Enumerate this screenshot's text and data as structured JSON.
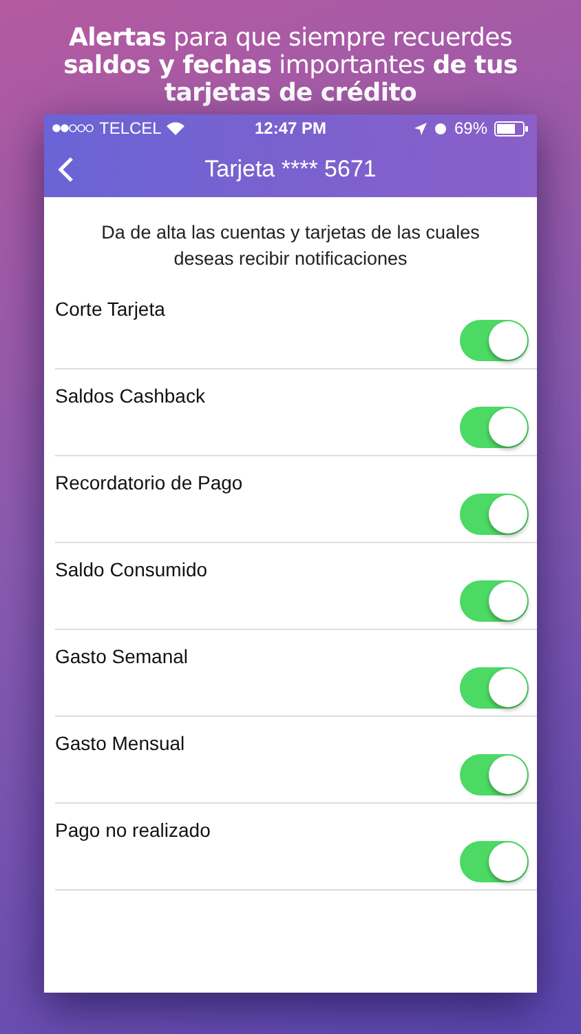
{
  "headline": "**Alertas** para que siempre recuerdes **saldos y fechas** importantes **de tus tarjetas de crédito**",
  "status_bar": {
    "carrier": "TELCEL",
    "time": "12:47 PM",
    "battery": "69%"
  },
  "nav": {
    "title": "Tarjeta **** 5671"
  },
  "intro": "Da de alta las cuentas y tarjetas de las cuales deseas recibir notificaciones",
  "settings": [
    {
      "label": "Corte Tarjeta",
      "on": true
    },
    {
      "label": "Saldos Cashback",
      "on": true
    },
    {
      "label": "Recordatorio de Pago",
      "on": true
    },
    {
      "label": "Saldo Consumido",
      "on": true
    },
    {
      "label": "Gasto Semanal",
      "on": true
    },
    {
      "label": "Gasto Mensual",
      "on": true
    },
    {
      "label": "Pago no realizado",
      "on": true
    }
  ]
}
